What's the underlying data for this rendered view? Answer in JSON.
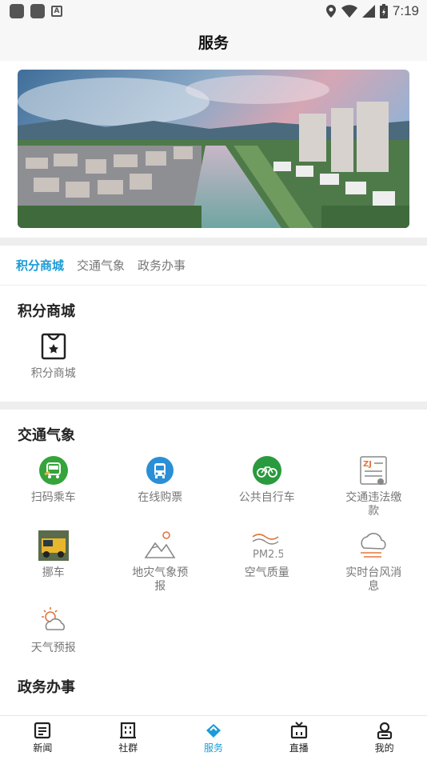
{
  "status_bar": {
    "time": "7:19"
  },
  "header": {
    "title": "服务"
  },
  "tabs": [
    {
      "label": "积分商城",
      "active": true
    },
    {
      "label": "交通气象",
      "active": false
    },
    {
      "label": "政务办事",
      "active": false
    }
  ],
  "sections": [
    {
      "title": "积分商城",
      "items": [
        {
          "label": "积分商城",
          "icon": "shopping-bag-icon"
        }
      ]
    },
    {
      "title": "交通气象",
      "items": [
        {
          "label": "扫码乘车",
          "icon": "qr-bus-icon"
        },
        {
          "label": "在线购票",
          "icon": "bus-ticket-icon"
        },
        {
          "label": "公共自行车",
          "icon": "bicycle-icon"
        },
        {
          "label": "交通违法缴款",
          "icon": "traffic-fine-icon"
        },
        {
          "label": "挪车",
          "icon": "tow-truck-icon"
        },
        {
          "label": "地灾气象预报",
          "icon": "mountain-sun-icon"
        },
        {
          "label": "空气质量",
          "icon": "air-quality-icon"
        },
        {
          "label": "实时台风消息",
          "icon": "typhoon-icon"
        },
        {
          "label": "天气预报",
          "icon": "weather-icon"
        }
      ]
    },
    {
      "title": "政务办事",
      "items": []
    }
  ],
  "bottom_nav": [
    {
      "label": "新闻",
      "icon": "news-icon",
      "active": false
    },
    {
      "label": "社群",
      "icon": "community-icon",
      "active": false
    },
    {
      "label": "服务",
      "icon": "service-icon",
      "active": true
    },
    {
      "label": "直播",
      "icon": "tv-icon",
      "active": false
    },
    {
      "label": "我的",
      "icon": "profile-icon",
      "active": false
    }
  ],
  "colors": {
    "accent": "#1a9bd7",
    "green": "#35a43a",
    "orange": "#e3763c"
  }
}
